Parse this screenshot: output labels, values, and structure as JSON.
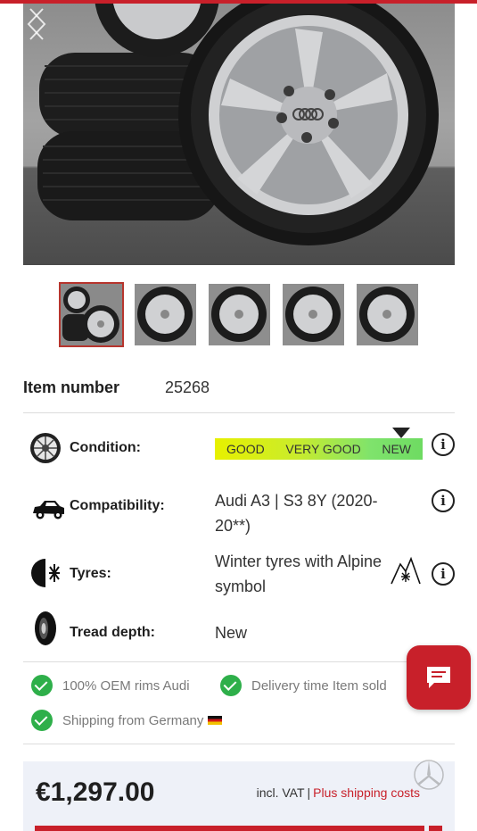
{
  "item": {
    "label": "Item number",
    "value": "25268"
  },
  "specs": {
    "condition": {
      "label": "Condition:",
      "scale": [
        "GOOD",
        "VERY GOOD",
        "NEW"
      ],
      "selected": "NEW",
      "info": "i"
    },
    "compatibility": {
      "label": "Compatibility:",
      "value": "Audi A3 | S3 8Y (2020-20**)",
      "info": "i"
    },
    "tyres": {
      "label": "Tyres:",
      "value": "Winter tyres with Alpine symbol",
      "icon": "alpine-snowflake-icon",
      "info": "i"
    },
    "tread": {
      "label": "Tread depth:",
      "value": "New"
    }
  },
  "perks": [
    "100% OEM rims Audi",
    "Delivery time Item sold",
    "Shipping from Germany"
  ],
  "price": {
    "amount": "€1,297.00",
    "vat": "incl. VAT",
    "separator": "|",
    "shipping_link": "Plus shipping costs"
  },
  "colors": {
    "accent": "#c8202a",
    "check": "#2eaf4a",
    "price_bg": "#eef1f8"
  }
}
